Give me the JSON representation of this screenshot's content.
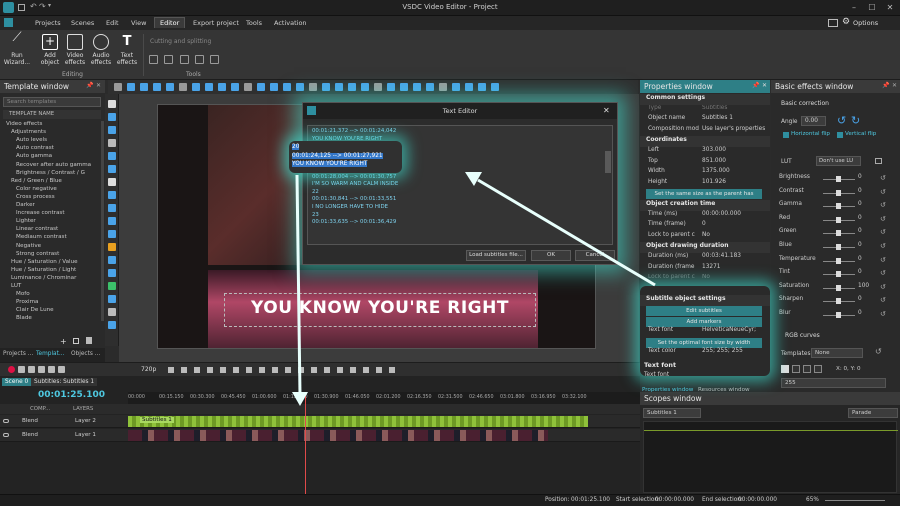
{
  "window": {
    "title": "VSDC Video Editor - Project",
    "options": "Options"
  },
  "menu": [
    "Projects",
    "Scenes",
    "Edit",
    "View",
    "Editor",
    "Export project",
    "Tools",
    "Activation"
  ],
  "ribbon": {
    "run_wizard": "Run Wizard...",
    "add_object": "Add object",
    "video_effects": "Video effects",
    "audio_effects": "Audio effects",
    "text_effects": "Text effects",
    "editing_group": "Editing",
    "cutting": "Cutting and splitting",
    "tools_group": "Tools"
  },
  "template_window": {
    "title": "Template window",
    "search_placeholder": "Search templates",
    "column": "TEMPLATE NAME",
    "items": [
      "Video effects",
      "Adjustments",
      "Auto levels",
      "Auto contrast",
      "Auto gamma",
      "Recover after auto gamma",
      "Brightness / Contrast / G",
      "Red / Green / Blue",
      "Color negative",
      "Cross process",
      "Darker",
      "Increase contrast",
      "Lighter",
      "Linear contrast",
      "Mediaum contrast",
      "Negative",
      "Strong contrast",
      "Hue / Saturation / Value",
      "Hue / Saturation / Light",
      "Luminance / Chrominar",
      "LUT",
      "Mofo",
      "Proxima",
      "Clair De Lune",
      "Blade"
    ],
    "tabs": [
      "Projects ...",
      "Templat...",
      "Objects ..."
    ]
  },
  "text_editor": {
    "title": "Text Editor",
    "lines": [
      "00:01:21,372 --> 00:01:24,042",
      "YOU KNOW YOU'RE RIGHT",
      "20",
      "00:01:24,125 --> 00:01:27,921",
      "YOU KNOW YOU'RE RIGHT",
      "21",
      "00:01:28,004 --> 00:01:30,757",
      "I'M SO WARM AND CALM INSIDE",
      "22",
      "00:01:30,841 --> 00:01:33,551",
      "I NO LONGER HAVE TO HIDE",
      "23",
      "00:01:33,635 --> 00:01:36,429"
    ],
    "load_button": "Load subtitles file...",
    "ok_button": "OK",
    "cancel_button": "Cancel"
  },
  "canvas": {
    "subtitle": "YOU KNOW YOU'RE RIGHT"
  },
  "properties": {
    "title": "Properties window",
    "common": "Common settings",
    "type_k": "Type",
    "type_v": "Subtitles",
    "name_k": "Object name",
    "name_v": "Subtitles 1",
    "comp_k": "Composition mod",
    "comp_v": "Use layer's properties",
    "coords": "Coordinates",
    "left_k": "Left",
    "left_v": "303.000",
    "top_k": "Top",
    "top_v": "851.000",
    "width_k": "Width",
    "width_v": "1375.000",
    "height_k": "Height",
    "height_v": "101.926",
    "same_size": "Set the same size as the parent has",
    "creation": "Object creation time",
    "time_ms_k": "Time (ms)",
    "time_ms_v": "00:00:00.000",
    "time_fr_k": "Time (frame)",
    "time_fr_v": "0",
    "lock_k": "Lock to parent c",
    "lock_v": "No",
    "duration": "Object drawing duration",
    "dur_ms_k": "Duration (ms)",
    "dur_ms_v": "00:03:41.183",
    "dur_fr_k": "Duration (frame",
    "dur_fr_v": "13271",
    "lock2_k": "Lock to parent c",
    "lock2_v": "No",
    "subtitle_settings": "Subtitle object settings",
    "edit_subtitles": "Edit subtitles",
    "add_markers": "Add markers",
    "font_k": "Text font",
    "font_v": "HelveticaNeueCyr;",
    "optimal_font": "Set the optimal font size by width",
    "text_color_k": "Text color",
    "text_color_v": "255; 255; 255",
    "desc_title": "Text font",
    "desc_text": "Text font",
    "tabs": [
      "Properties window",
      "Resources window"
    ]
  },
  "basic_effects": {
    "title": "Basic effects window",
    "correction": "Basic correction",
    "angle_label": "Angle",
    "angle_value": "0.00",
    "hflip": "Horizontal flip",
    "vflip": "Vertical flip",
    "lut_label": "LUT",
    "lut_value": "Don't use LU",
    "rows": [
      {
        "label": "Brightness",
        "value": "0"
      },
      {
        "label": "Contrast",
        "value": "0"
      },
      {
        "label": "Gamma",
        "value": "0"
      },
      {
        "label": "Red",
        "value": "0"
      },
      {
        "label": "Green",
        "value": "0"
      },
      {
        "label": "Blue",
        "value": "0"
      },
      {
        "label": "Temperature",
        "value": "0"
      },
      {
        "label": "Tint",
        "value": "0"
      },
      {
        "label": "Saturation",
        "value": "100"
      },
      {
        "label": "Sharpen",
        "value": "0"
      },
      {
        "label": "Blur",
        "value": "0"
      }
    ],
    "rgb_curves": "RGB curves",
    "templates_label": "Templates:",
    "templates_value": "None",
    "coord_readout": "X: 0, Y: 0",
    "curve_value": "255"
  },
  "transport": {
    "quality": "720p"
  },
  "timeline": {
    "tabs": [
      "Scene 0",
      "Subtitles: Subtitles 1"
    ],
    "time": "00:01:25.100",
    "ruler": [
      "00:000",
      "00:15.150",
      "00:30.300",
      "00:45.450",
      "01:00.600",
      "01:15.750",
      "01:30.900",
      "01:46.050",
      "02:01.200",
      "02:16.350",
      "02:31.500",
      "02:46.650",
      "03:01.800",
      "03:16.950",
      "03:32.100"
    ],
    "header": {
      "comp": "COMP...",
      "layers": "LAYERS"
    },
    "layers": [
      {
        "blend": "Blend",
        "name": "Layer 2",
        "clip": "Subtitles 1"
      },
      {
        "blend": "Blend",
        "name": "Layer 1",
        "clip": ""
      }
    ]
  },
  "scopes": {
    "title": "Scopes window",
    "source": "Subtitles 1",
    "mode": "Parade"
  },
  "status": {
    "position_k": "Position:",
    "position_v": "00:01:25.100",
    "start_k": "Start selection:",
    "start_v": "00:00:00.000",
    "end_k": "End selection:",
    "end_v": "00:00:00.000",
    "zoom": "65%"
  }
}
